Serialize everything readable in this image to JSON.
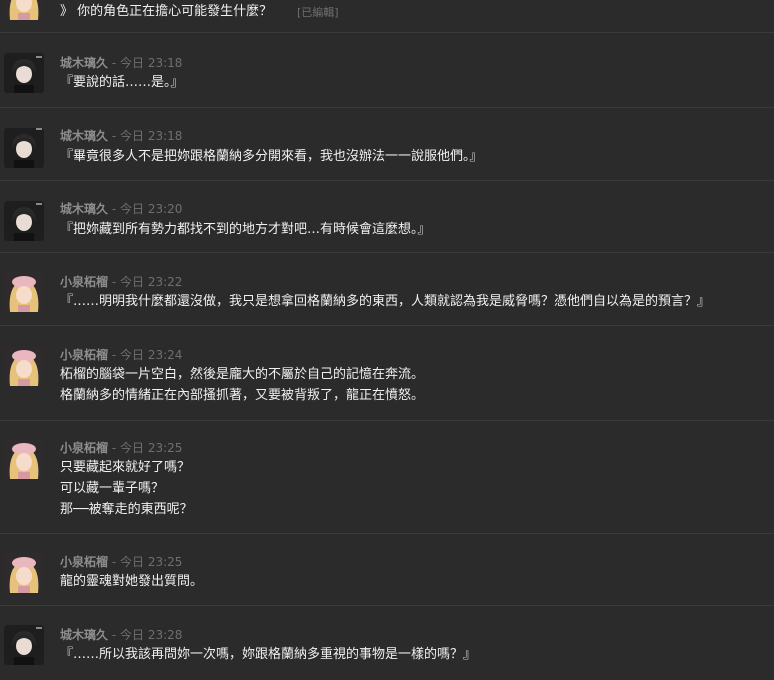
{
  "messages": [
    {
      "author": "",
      "sep": "",
      "time": "",
      "avatar": "kosumi-icon",
      "lines": [
        "》 你的角色正在擔心可能發生什麼？"
      ],
      "edited": "[已編輯]"
    },
    {
      "author": "城木璃久",
      "sep": "-",
      "time": "今日 23:18",
      "avatar": "shiroki-icon",
      "lines": [
        "『要說的話……是。』"
      ]
    },
    {
      "author": "城木璃久",
      "sep": "-",
      "time": "今日 23:18",
      "avatar": "shiroki-icon",
      "lines": [
        "『畢竟很多人不是把妳跟格蘭納多分開來看，我也沒辦法一一說服他們。』"
      ]
    },
    {
      "author": "城木璃久",
      "sep": "-",
      "time": "今日 23:20",
      "avatar": "shiroki-icon",
      "lines": [
        "『把妳藏到所有勢力都找不到的地方才對吧…有時候會這麼想。』"
      ]
    },
    {
      "author": "小泉柘榴",
      "sep": "-",
      "time": "今日 23:22",
      "avatar": "kosumi-icon",
      "lines": [
        "『……明明我什麼都還沒做，我只是想拿回格蘭納多的東西，人類就認為我是威脅嗎？憑他們自以為是的預言？』"
      ]
    },
    {
      "author": "小泉柘榴",
      "sep": "-",
      "time": "今日 23:24",
      "avatar": "kosumi-icon",
      "lines": [
        "柘榴的腦袋一片空白，然後是龐大的不屬於自己的記憶在奔流。",
        "格蘭納多的情緒正在內部搔抓著，又要被背叛了，龍正在憤怒。"
      ]
    },
    {
      "author": "小泉柘榴",
      "sep": "-",
      "time": "今日 23:25",
      "avatar": "kosumi-icon",
      "lines": [
        "只要藏起來就好了嗎？",
        "可以藏一輩子嗎？",
        "那──被奪走的東西呢？"
      ]
    },
    {
      "author": "小泉柘榴",
      "sep": "-",
      "time": "今日 23:25",
      "avatar": "kosumi-icon",
      "lines": [
        "龍的靈魂對她發出質問。"
      ]
    },
    {
      "author": "城木璃久",
      "sep": "-",
      "time": "今日 23:28",
      "avatar": "shiroki-icon",
      "lines": [
        "『……所以我該再問妳一次嗎，妳跟格蘭納多重視的事物是一樣的嗎？』"
      ]
    }
  ]
}
